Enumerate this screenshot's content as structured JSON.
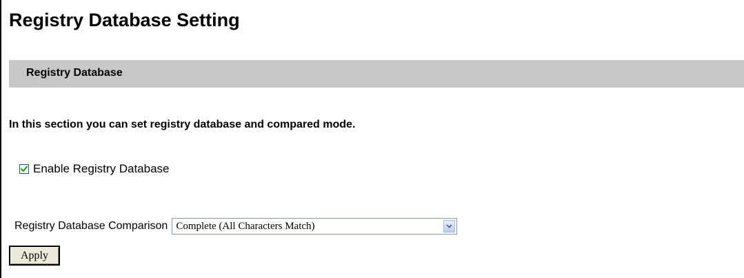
{
  "page": {
    "title": "Registry Database Setting"
  },
  "section": {
    "title": "Registry Database",
    "description": "In this section you can set registry database and compared mode."
  },
  "enable_checkbox": {
    "label": "Enable Registry Database",
    "checked": true
  },
  "comparison": {
    "label": "Registry Database Comparison",
    "selected": "Complete (All Characters Match)"
  },
  "apply_button": {
    "label": "Apply"
  },
  "colors": {
    "section_bar": "#c8c8c8",
    "checkmark": "#2c9b1a",
    "checkbox_border": "#1c5180",
    "select_border": "#7f9db9"
  },
  "icons": {
    "checkbox_mark": "check-icon",
    "dropdown_arrow": "chevron-down-icon"
  }
}
